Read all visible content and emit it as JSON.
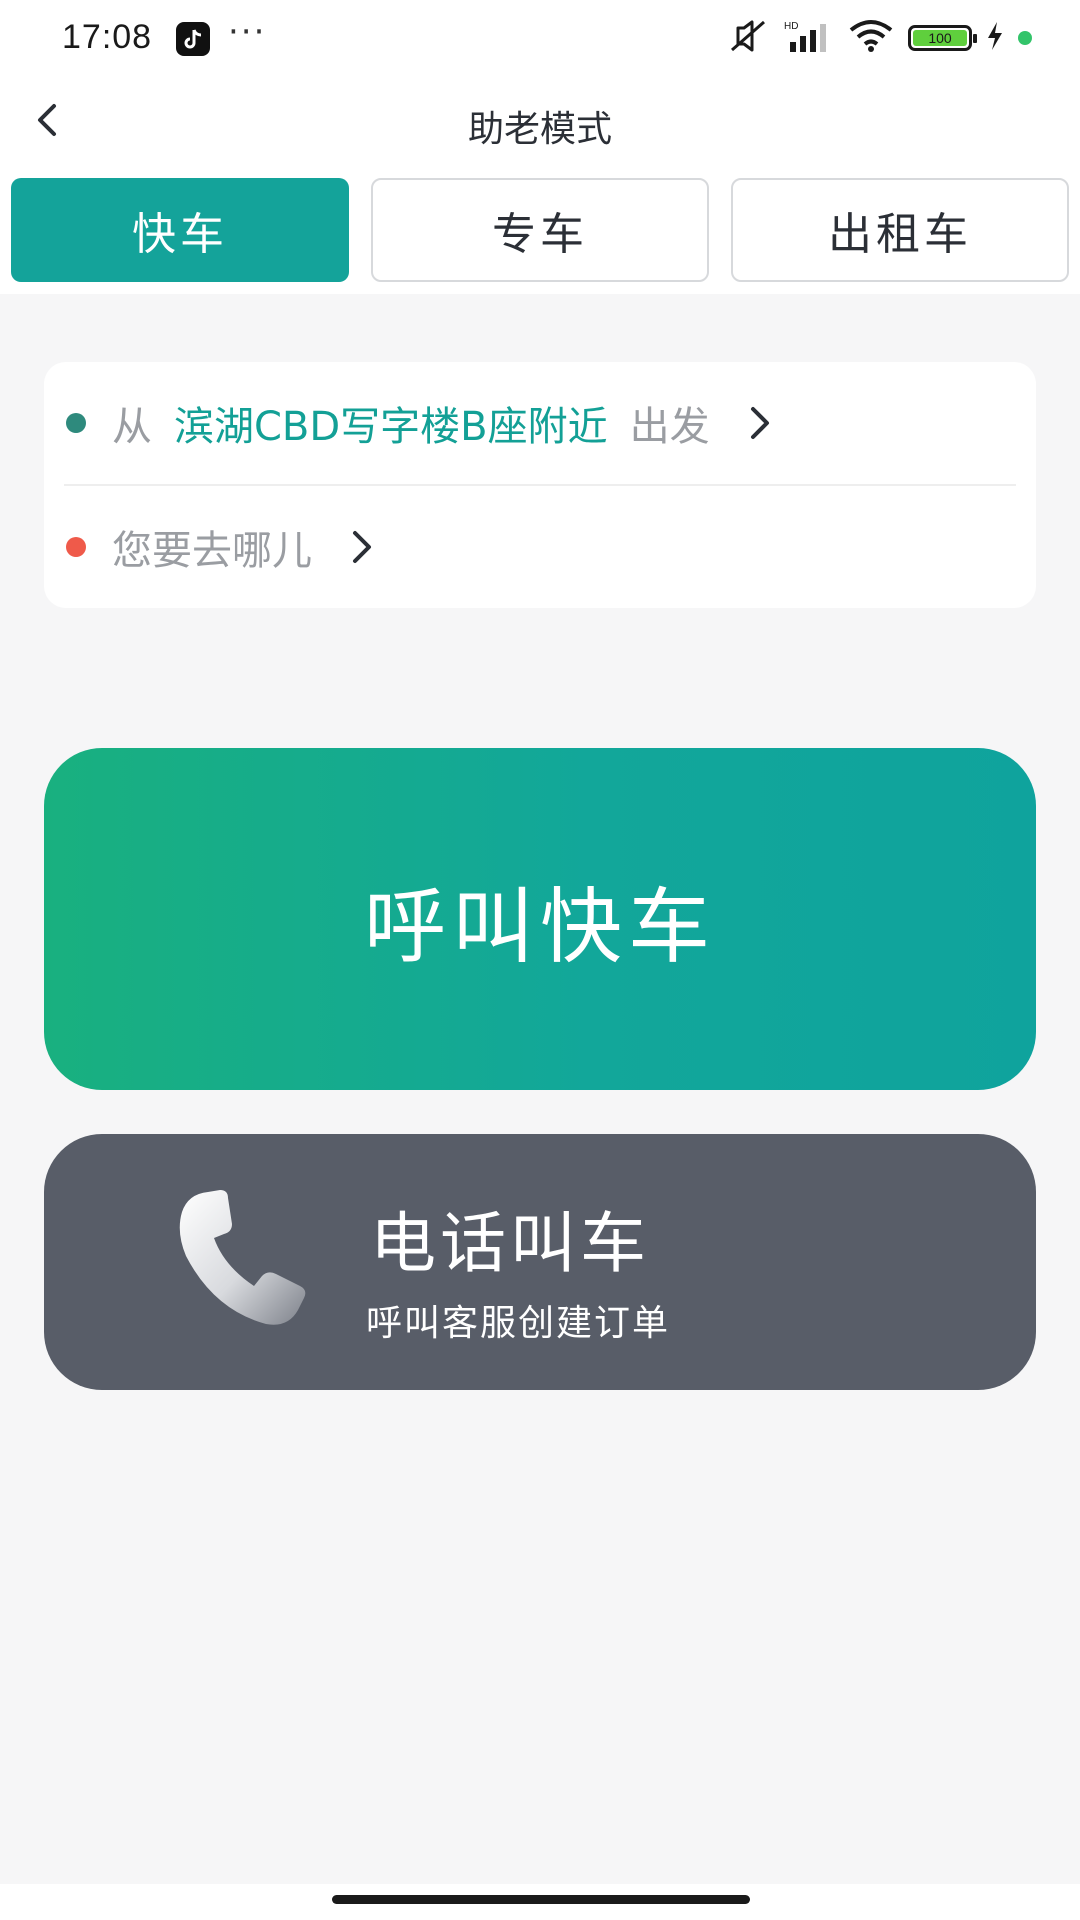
{
  "status_bar": {
    "time": "17:08",
    "dots": "···",
    "battery_level": "100",
    "icons": [
      "tiktok-icon",
      "more-dots-icon",
      "mute-icon",
      "hd-signal-icon",
      "wifi-icon",
      "battery-icon",
      "charging-icon",
      "green-dot-indicator"
    ]
  },
  "header": {
    "title": "助老模式",
    "back_icon": "chevron-left-icon"
  },
  "tabs": [
    {
      "label": "快车",
      "active": true
    },
    {
      "label": "专车",
      "active": false
    },
    {
      "label": "出租车",
      "active": false
    }
  ],
  "address": {
    "from_prefix": "从",
    "from_place": "滨湖CBD写字楼B座附近",
    "from_suffix": "出发",
    "to_placeholder": "您要去哪儿"
  },
  "call_express": {
    "label": "呼叫快车"
  },
  "phone_call": {
    "title": "电话叫车",
    "subtitle": "呼叫客服创建订单",
    "icon": "phone-icon"
  },
  "colors": {
    "accent": "#14a39a",
    "destination_dot": "#ef5a4a",
    "phone_button": "#585d68"
  }
}
